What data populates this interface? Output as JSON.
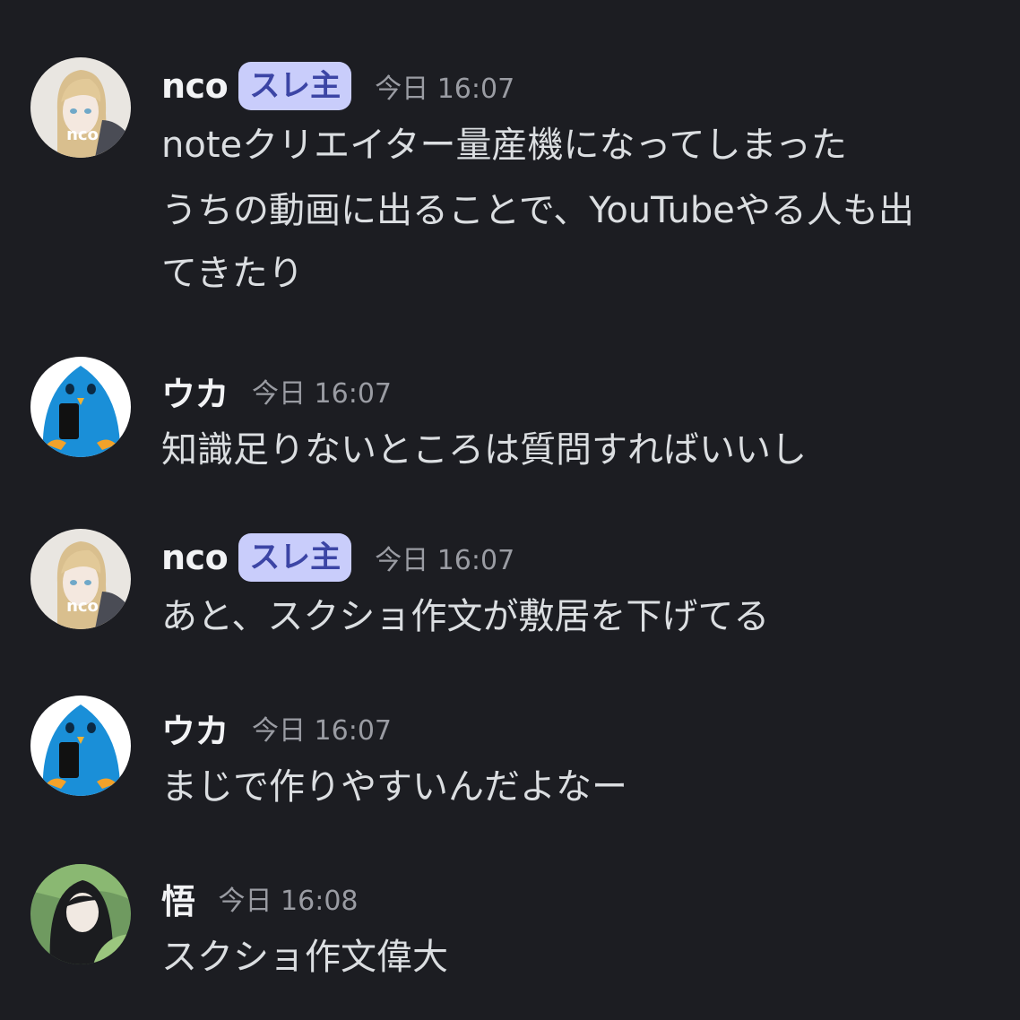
{
  "messages": [
    {
      "username": "nco",
      "badge": "スレ主",
      "timestamp": "今日 16:07",
      "lines": [
        "noteクリエイター量産機になってしまった"
      ],
      "avatar_label": "nco"
    },
    {
      "lines": [
        "うちの動画に出ることで、YouTubeやる人も出",
        "てきたり"
      ]
    },
    {
      "username": "ウカ",
      "timestamp": "今日 16:07",
      "lines": [
        "知識足りないところは質問すればいいし"
      ]
    },
    {
      "username": "nco",
      "badge": "スレ主",
      "timestamp": "今日 16:07",
      "lines": [
        "あと、スクショ作文が敷居を下げてる"
      ],
      "avatar_label": "nco"
    },
    {
      "username": "ウカ",
      "timestamp": "今日 16:07",
      "lines": [
        "まじで作りやすいんだよなー"
      ]
    },
    {
      "username": "悟",
      "timestamp": "今日 16:08",
      "lines": [
        "スクショ作文偉大"
      ]
    }
  ],
  "colors": {
    "background": "#1c1d22",
    "username": "#f2f3f5",
    "message_text": "#dbdee1",
    "timestamp": "#9a9ca3",
    "badge_bg": "#c9cdfb",
    "badge_text": "#3c45a5"
  }
}
